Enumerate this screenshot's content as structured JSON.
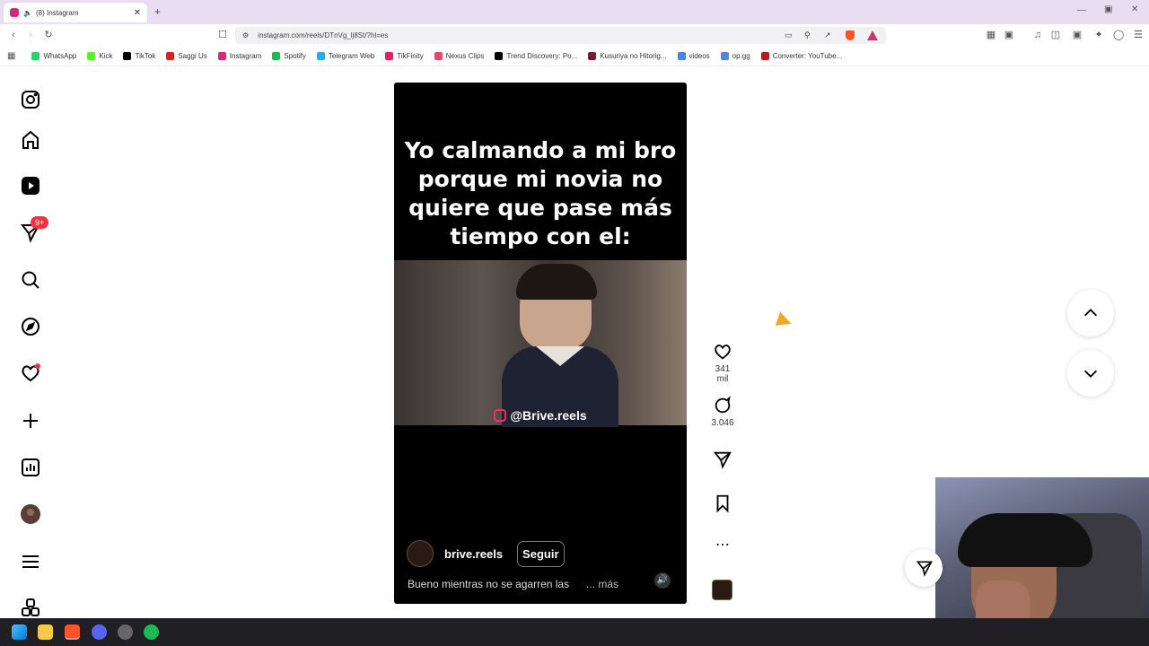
{
  "browser": {
    "tab_title": "(8) Instagram",
    "url": "instagram.com/reels/DTnVg_lj8St/?hl=es",
    "bookmarks": [
      {
        "label": "WhatsApp",
        "color": "#25d366"
      },
      {
        "label": "Kick",
        "color": "#53fc18"
      },
      {
        "label": "TikTok",
        "color": "#000000"
      },
      {
        "label": "Saggi Us",
        "color": "#e02020"
      },
      {
        "label": "Instagram",
        "color": "#d62976"
      },
      {
        "label": "Spotify",
        "color": "#1db954"
      },
      {
        "label": "Telegram Web",
        "color": "#2aabee"
      },
      {
        "label": "TikFinity",
        "color": "#e0245e"
      },
      {
        "label": "Nexus Clips",
        "color": "#e24a6b"
      },
      {
        "label": "Trend Discovery: Po...",
        "color": "#000000"
      },
      {
        "label": "Kusuriya no Hitorig...",
        "color": "#7a1d2a"
      },
      {
        "label": "videos",
        "color": "#4285f4"
      },
      {
        "label": "op.gg",
        "color": "#5383e8"
      },
      {
        "label": "Converter: YouTube...",
        "color": "#b71c1c"
      }
    ]
  },
  "sidebar": {
    "notification_badge": "9+",
    "items": [
      "instagram-logo",
      "home",
      "reels",
      "messages",
      "search",
      "explore",
      "notifications",
      "create",
      "dashboard",
      "profile",
      "more",
      "also-from-meta"
    ]
  },
  "reel": {
    "caption": "Yo calmando a mi bro porque mi novia no quiere que pase más tiempo con el:",
    "watermark": "@Brive.reels",
    "author": "brive.reels",
    "follow_label": "Seguir",
    "description": "Bueno mientras no se agarren las",
    "more_label": "... más"
  },
  "actions": {
    "likes": "341 mil",
    "comments": "3.046"
  }
}
